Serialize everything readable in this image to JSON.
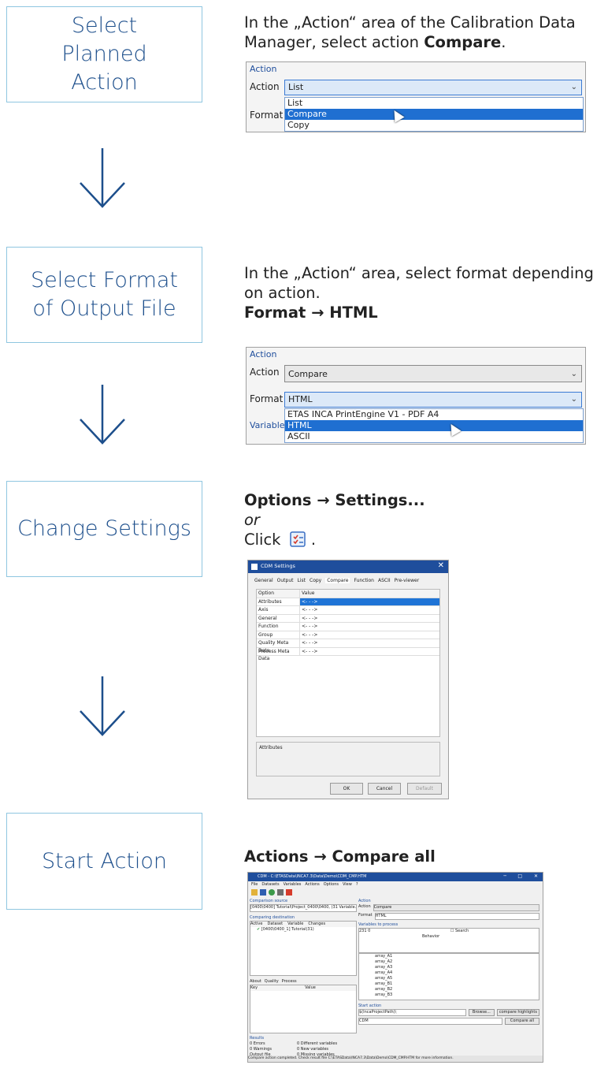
{
  "steps": [
    {
      "label": "Select Planned Action"
    },
    {
      "label": "Select Format of Output File"
    },
    {
      "label": "Change Settings"
    },
    {
      "label": "Start Action"
    }
  ],
  "step1": {
    "desc_a": "In the „Action“ area of the Calibration Data Manager, select action ",
    "desc_bold": "Compare",
    "desc_end": ".",
    "shot": {
      "group": "Action",
      "action_label": "Action",
      "action_value": "List",
      "format_label": "Format",
      "options": [
        "List",
        "Compare",
        "Copy"
      ],
      "selected": "Compare"
    }
  },
  "step2": {
    "desc": "In the „Action“ area, select format depending on action.",
    "desc_bold": "Format → HTML",
    "shot": {
      "group": "Action",
      "action_label": "Action",
      "action_value": "Compare",
      "format_label": "Format",
      "format_value": "HTML",
      "variables_label": "Variables",
      "options": [
        "ETAS INCA PrintEngine V1 - PDF A4",
        "HTML",
        "ASCII"
      ],
      "selected": "HTML"
    }
  },
  "step3": {
    "line1": "Options → Settings...",
    "line2": "or",
    "line3": "Click",
    "line3_end": ".",
    "dialog": {
      "title": "CDM Settings",
      "tabs": [
        "General",
        "Output",
        "List",
        "Copy",
        "Compare",
        "Function",
        "ASCII",
        "Pre-viewer"
      ],
      "active_tab": "Compare",
      "col_option": "Option",
      "col_value": "Value",
      "rows": [
        {
          "option": "Attributes",
          "value": "<- - ->"
        },
        {
          "option": "Axis",
          "value": "<- - ->"
        },
        {
          "option": "General",
          "value": "<- - ->"
        },
        {
          "option": "Function",
          "value": "<- - ->"
        },
        {
          "option": "Group",
          "value": "<- - ->"
        },
        {
          "option": "Quality Meta Data",
          "value": "<- - ->"
        },
        {
          "option": "Process Meta Data",
          "value": "<- - ->"
        }
      ],
      "desc_label": "Attributes",
      "ok": "OK",
      "cancel": "Cancel",
      "default": "Default"
    }
  },
  "step4": {
    "desc": "Actions → Compare all",
    "app": {
      "title": "CDM - C:\\ETASData\\INCA7.3\\Data\\Demo\\CDM_CMP.HTM",
      "menu": [
        "File",
        "Datasets",
        "Variables",
        "Actions",
        "Options",
        "View",
        "?"
      ],
      "comparison_source": "Comparison source",
      "source_value": "[0400\\0400] Tutorial\\Project_0400\\0400, (31 Variable...",
      "comparing_destination": "Comparing destination",
      "dest_cols": [
        "Active",
        "Dataset",
        "Variable",
        "Changes"
      ],
      "dest_value": "[0400\\0400_1] Tutorial(31)",
      "info_tabs": [
        "About",
        "Quality",
        "Process"
      ],
      "info_cols": [
        "Key",
        "Value"
      ],
      "action_group": "Action",
      "action_label": "Action",
      "action_value": "Compare",
      "format_label": "Format",
      "format_value": "HTML",
      "vars_label": "Variables to process",
      "var_count": "231",
      "var_zero": "0",
      "search": "Search",
      "behavior": "Behavior",
      "variables": [
        "array_A1",
        "array_A2",
        "array_A3",
        "array_A4",
        "array_A5",
        "array_B1",
        "array_B2",
        "array_B3"
      ],
      "results": "Results",
      "result_items": [
        "0 Errors",
        "0 Different variables",
        "0 Warnings",
        "0 New variables",
        "Output file",
        "0 Missing variables"
      ],
      "view_btn": "View",
      "start_action": "Start action",
      "project_path": "$(IncaProjectPath)\\",
      "browse": "Browse...",
      "compare_highlights": "compare highlights",
      "cdm": "CDM",
      "compare_all": "Compare all",
      "status": "Compare action completed. Check result file C:\\ETASData\\INCA7.3\\Data\\Demo\\CDM_CMP.HTM for more information."
    }
  }
}
